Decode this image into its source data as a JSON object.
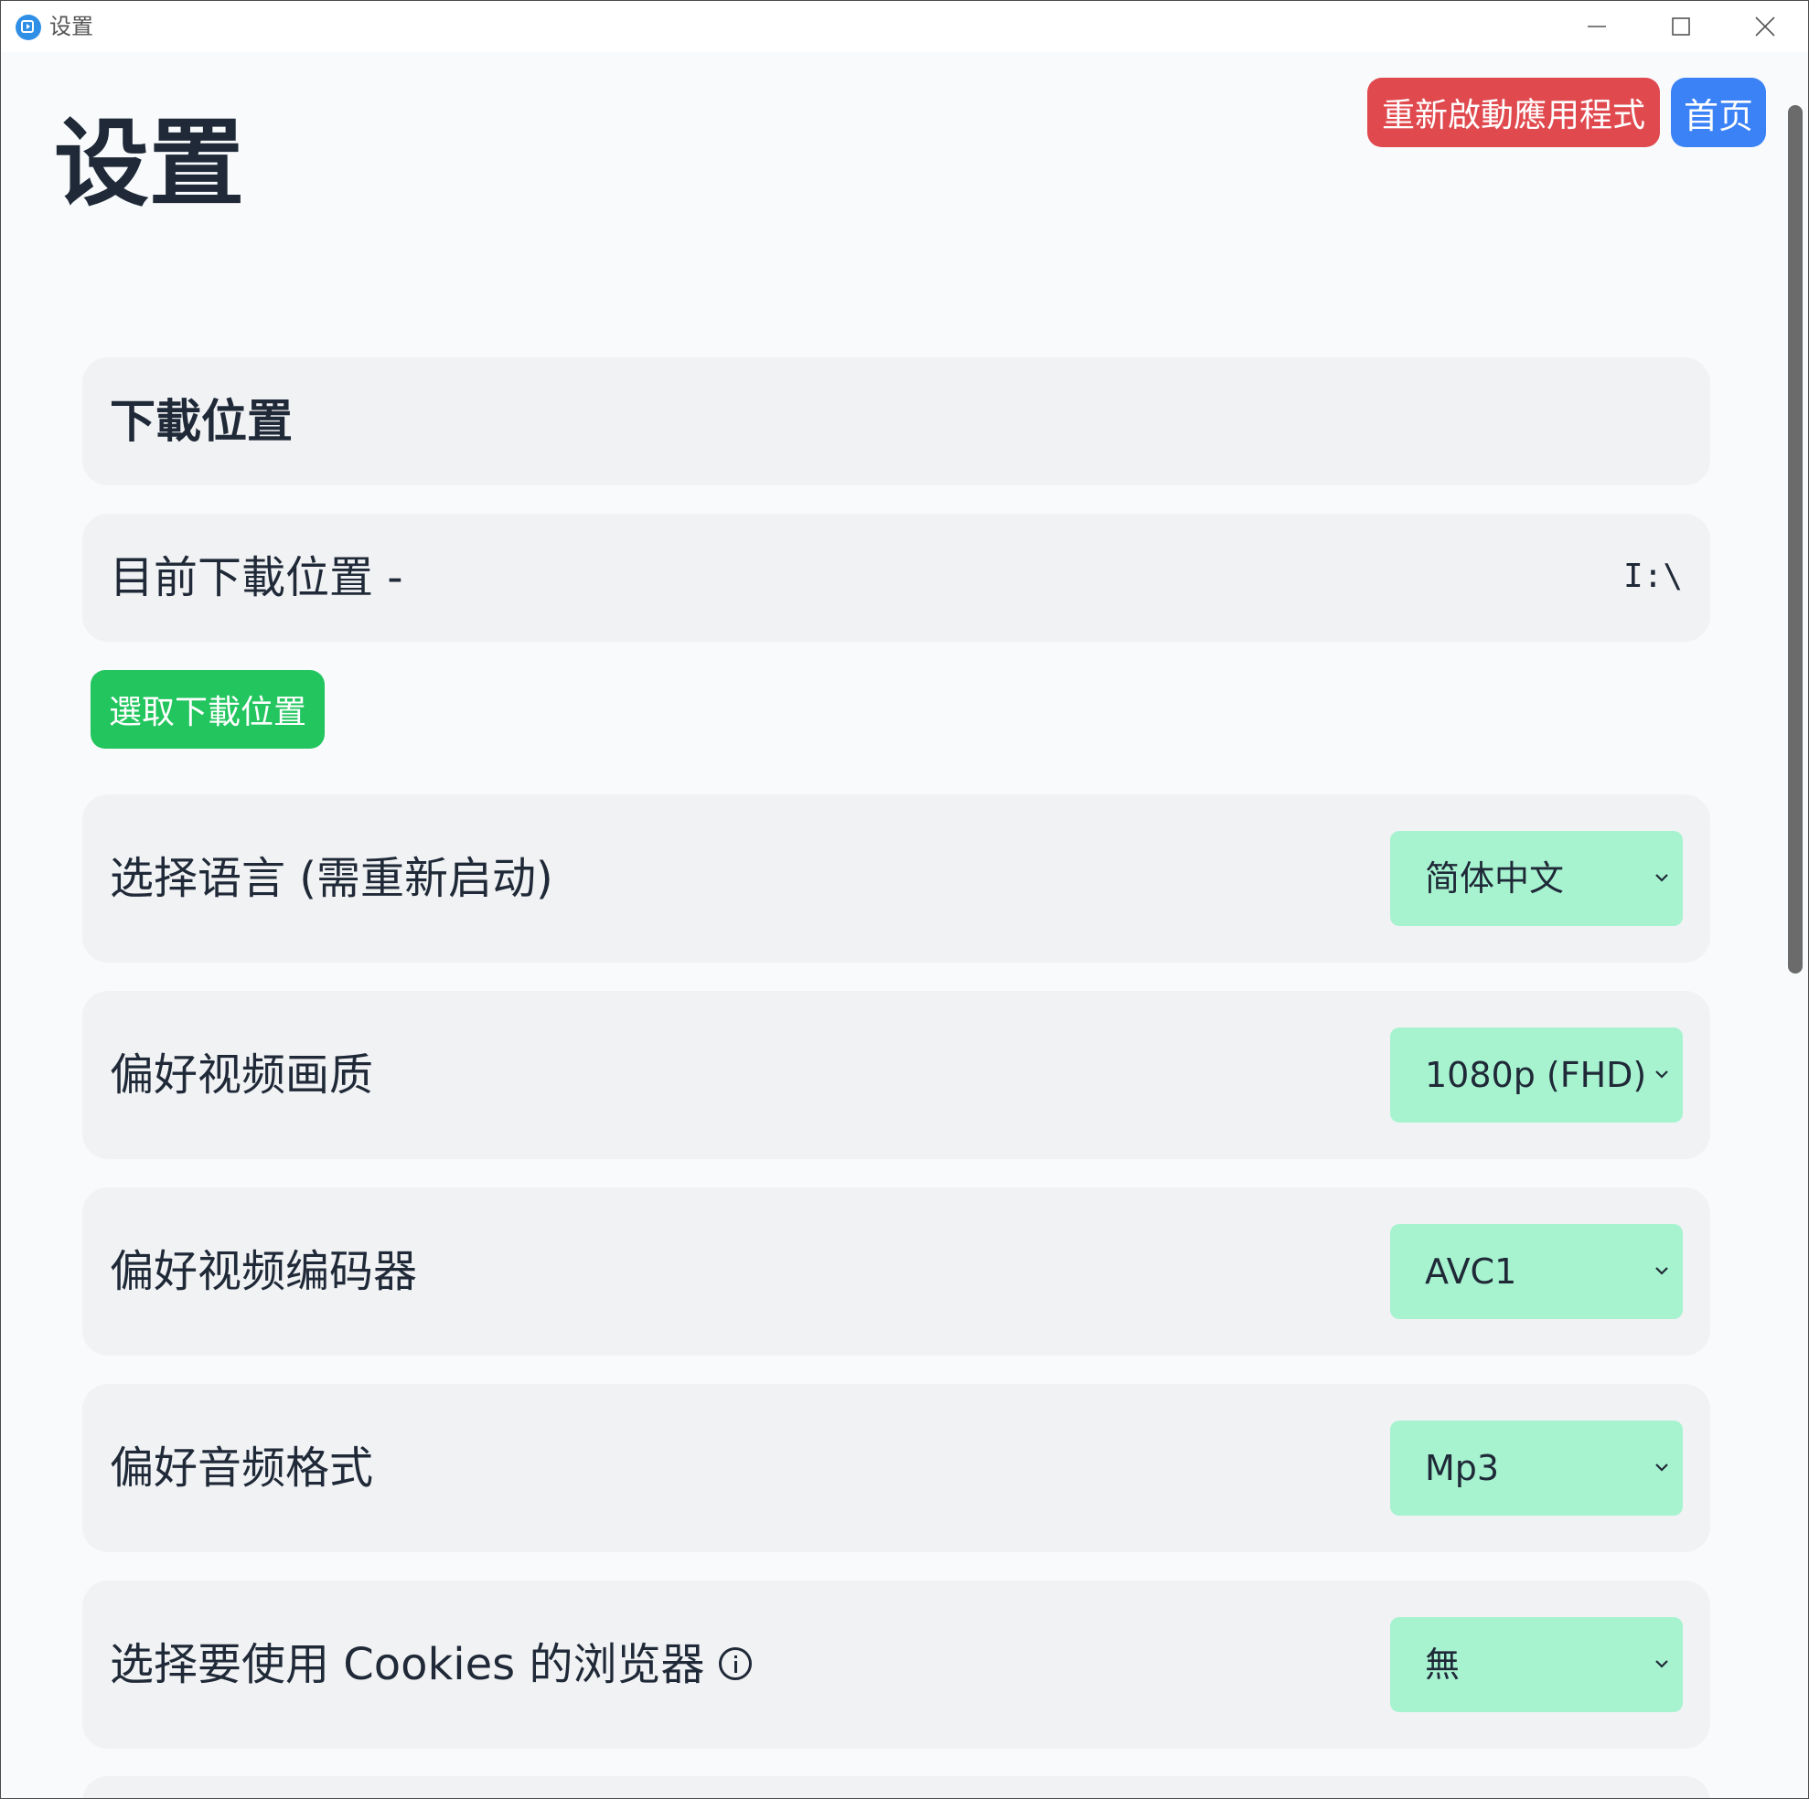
{
  "window": {
    "title": "设置"
  },
  "header": {
    "title": "设置",
    "restart_label": "重新啟動應用程式",
    "home_label": "首页"
  },
  "download": {
    "section_title": "下載位置",
    "current_label": "目前下載位置 -",
    "current_value": "I:\\",
    "pick_label": "選取下載位置"
  },
  "settings": [
    {
      "label": "选择语言 (需重新启动)",
      "value": "简体中文"
    },
    {
      "label": "偏好视频画质",
      "value": "1080p (FHD)"
    },
    {
      "label": "偏好视频编码器",
      "value": "AVC1"
    },
    {
      "label": "偏好音频格式",
      "value": "Mp3"
    },
    {
      "label": "选择要使用 Cookies 的浏览器",
      "value": "無",
      "info_icon": "info-icon"
    }
  ],
  "colors": {
    "restart": "#e04a4f",
    "home": "#3b82f6",
    "pick": "#22c55e",
    "select_bg": "#a7f3d0",
    "card_bg": "#f1f2f4",
    "page_bg": "#f8fafc"
  }
}
